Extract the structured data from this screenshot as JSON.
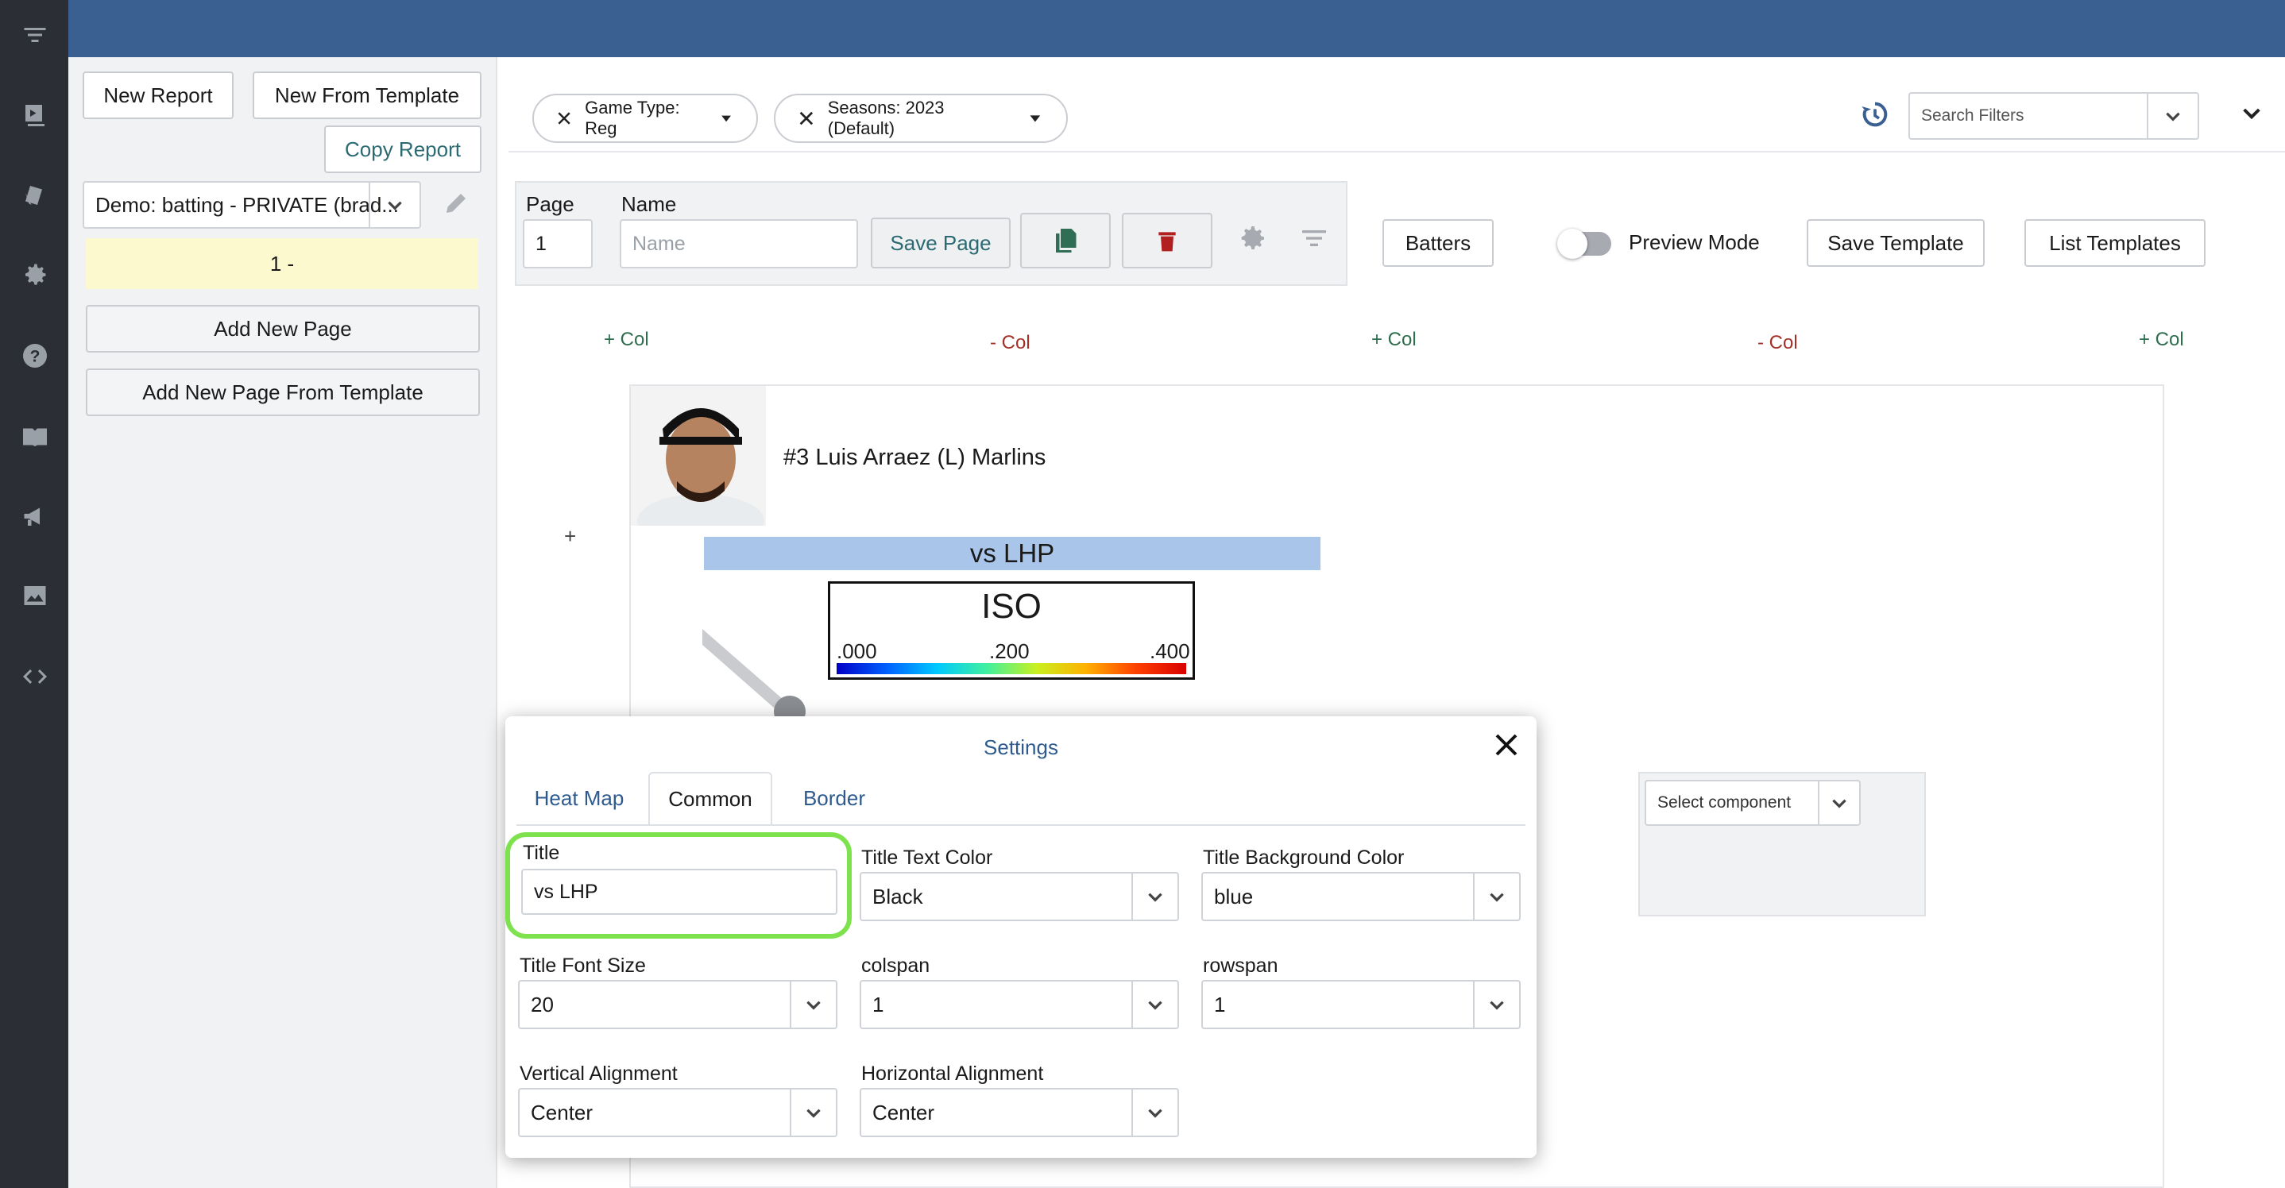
{
  "rail": {
    "icons": [
      "filter-icon",
      "video-icon",
      "cards-icon",
      "gear-icon",
      "help-icon",
      "book-icon",
      "megaphone-icon",
      "image-icon",
      "code-icon"
    ]
  },
  "left": {
    "new_report": "New Report",
    "new_from_template": "New From Template",
    "copy_report": "Copy Report",
    "report_select": "Demo: batting - PRIVATE (brad...",
    "page_item": "1 -",
    "add_new_page": "Add New Page",
    "add_new_page_from_template": "Add New Page From Template"
  },
  "filters": {
    "chips": [
      "Game Type: Reg",
      "Seasons: 2023 (Default)"
    ],
    "search_placeholder": "Search Filters"
  },
  "toolbar": {
    "page_label": "Page",
    "page_value": "1",
    "name_label": "Name",
    "name_placeholder": "Name",
    "save_page": "Save Page",
    "batters": "Batters",
    "preview_mode": "Preview Mode",
    "save_template": "Save Template",
    "list_templates": "List Templates"
  },
  "columns": {
    "add": "+ Col",
    "remove": "- Col",
    "row_add": "+"
  },
  "player": {
    "name": "#3 Luis Arraez (L) Marlins",
    "heatmap_title": "vs LHP",
    "legend_title": "ISO",
    "legend_ticks": [
      ".000",
      ".200",
      ".400"
    ]
  },
  "component_select": "Select component",
  "modal": {
    "title": "Settings",
    "tabs": [
      "Heat Map",
      "Common",
      "Border"
    ],
    "active_tab": "Common",
    "fields": {
      "title_label": "Title",
      "title_value": "vs LHP",
      "text_color_label": "Title Text Color",
      "text_color_value": "Black",
      "bg_color_label": "Title Background Color",
      "bg_color_value": "blue",
      "font_size_label": "Title Font Size",
      "font_size_value": "20",
      "colspan_label": "colspan",
      "colspan_value": "1",
      "rowspan_label": "rowspan",
      "rowspan_value": "1",
      "valign_label": "Vertical Alignment",
      "valign_value": "Center",
      "halign_label": "Horizontal Alignment",
      "halign_value": "Center"
    }
  },
  "colors": {
    "topbar": "#3a5f91",
    "highlight": "#7ee24f",
    "title_bg": "#a9c6ea",
    "page_item_bg": "#fdf9cf"
  }
}
